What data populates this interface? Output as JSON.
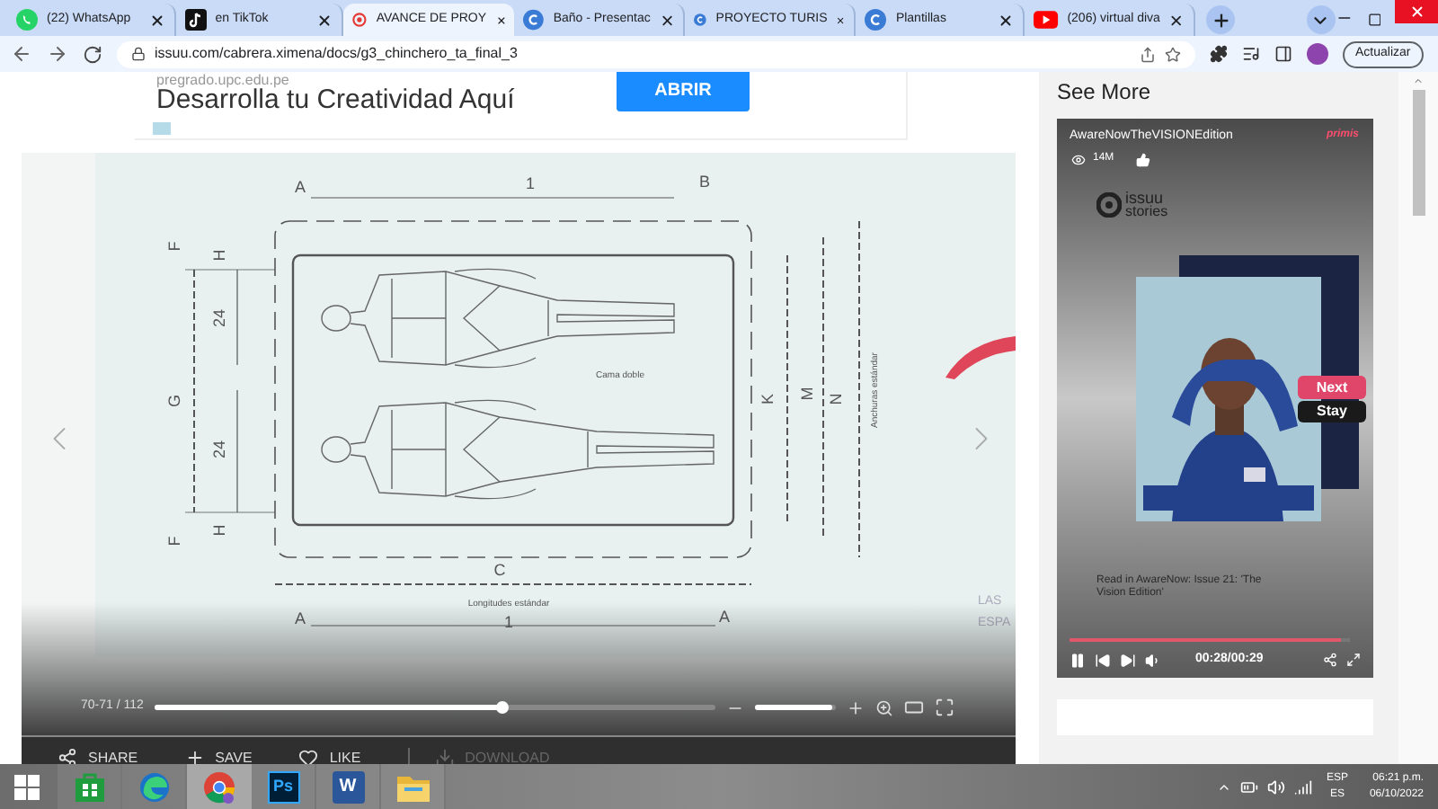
{
  "tabs": [
    {
      "title": "(22) WhatsApp",
      "kind": "whatsapp",
      "selected": false
    },
    {
      "title": "en TikTok",
      "kind": "tiktok",
      "selected": false
    },
    {
      "title": "AVANCE DE PROY",
      "kind": "target",
      "selected": true
    },
    {
      "title": "Baño - Presentac",
      "kind": "canva",
      "selected": false
    },
    {
      "title": "PROYECTO TURIS",
      "kind": "canva",
      "selected": false
    },
    {
      "title": "Plantillas",
      "kind": "canva",
      "selected": false
    },
    {
      "title": "(206) virtual diva",
      "kind": "youtube",
      "selected": false
    }
  ],
  "address": "issuu.com/cabrera.ximena/docs/g3_chinchero_ta_final_3",
  "update_button": "Actualizar",
  "ad": {
    "domain": "pregrado.upc.edu.pe",
    "headline": "Desarrolla tu Creatividad Aquí",
    "button": "ABRIR"
  },
  "document": {
    "top_labels": [
      "A",
      "1",
      "B"
    ],
    "left_labels": [
      "F",
      "H",
      "24",
      "G",
      "24",
      "H",
      "F"
    ],
    "bottom_labels": [
      "C",
      "Longitudes estándar",
      "A",
      "1",
      "A"
    ],
    "right_labels": [
      "K",
      "M",
      "N",
      "Anchuras estándar"
    ],
    "caption": "Cama doble",
    "edge_text": [
      "LAS",
      "ESPA"
    ]
  },
  "viewer": {
    "page_counter": "70-71 / 112",
    "level": 0.62,
    "zoom": {
      "level": 0.96
    },
    "actions": [
      {
        "label": "SHARE",
        "kind": "share",
        "disabled": false
      },
      {
        "label": "SAVE",
        "kind": "save",
        "disabled": false
      },
      {
        "label": "LIKE",
        "kind": "like",
        "disabled": false
      },
      {
        "label": "DOWNLOAD",
        "kind": "download",
        "disabled": true
      }
    ]
  },
  "sidebar": {
    "heading": "See More",
    "video": {
      "title": "AwareNowTheVISIONEdition",
      "brand": "primis",
      "views": "14M",
      "logo_text": "issuu",
      "logo_sub": "stories",
      "next": "Next",
      "stay": "Stay",
      "caption": "Read in AwareNow: Issue 21: 'The Vision Edition'",
      "time": "00:28/00:29",
      "level": 0.97
    }
  },
  "taskbar": {
    "apps": [
      {
        "kind": "store",
        "selected": false
      },
      {
        "kind": "edge",
        "selected": false
      },
      {
        "kind": "chrome",
        "selected": true
      },
      {
        "kind": "photoshop",
        "label": "Ps",
        "selected": false
      },
      {
        "kind": "word",
        "label": "W",
        "selected": false
      },
      {
        "kind": "folder",
        "selected": false
      }
    ],
    "lang": "ESP",
    "lang_sub": "ES",
    "time": "06:21 p.m.",
    "date": "06/10/2022"
  }
}
